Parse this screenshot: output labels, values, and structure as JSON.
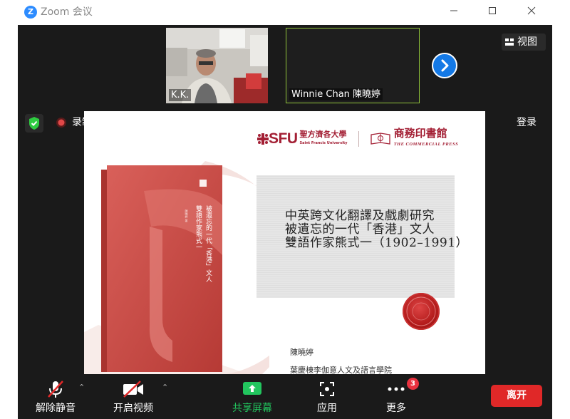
{
  "window": {
    "app_title": "Zoom 会议",
    "logo_letter": "Z"
  },
  "gallery": {
    "participants": [
      {
        "name": "K.K."
      },
      {
        "name": "Winnie Chan 陳曉婷"
      }
    ],
    "view_label": "视图"
  },
  "top_bar": {
    "record_label": "录制",
    "signin_label": "登录"
  },
  "slide": {
    "sfu_logo_text": "SFU",
    "sfu_chinese": "聖方濟各大學",
    "sfu_english": "Saint Francis University",
    "publisher_chinese": "商務印書館",
    "publisher_english": "THE COMMERCIAL PRESS",
    "title_lines": [
      "中英跨文化翻譯及戲劇研究",
      "被遺忘的一代「香港」文人",
      "雙語作家熊式一（1902–1991）"
    ],
    "author": "陳曉婷",
    "affiliation": "葉慶棟李伽意人文及語言學院",
    "book_title": "被遺忘的一代「香港」文人",
    "book_subtitle": "雙語作家熊式一"
  },
  "toolbar": {
    "unmute_label": "解除静音",
    "start_video_label": "开启视频",
    "share_screen_label": "共享屏幕",
    "apps_label": "应用",
    "more_label": "更多",
    "more_badge": "3",
    "leave_label": "离开"
  },
  "colors": {
    "accent_green": "#8fc23a",
    "share_green": "#22c55e",
    "zoom_blue": "#2d8cff",
    "leave_red": "#e02828",
    "brand_red": "#a31f34"
  }
}
